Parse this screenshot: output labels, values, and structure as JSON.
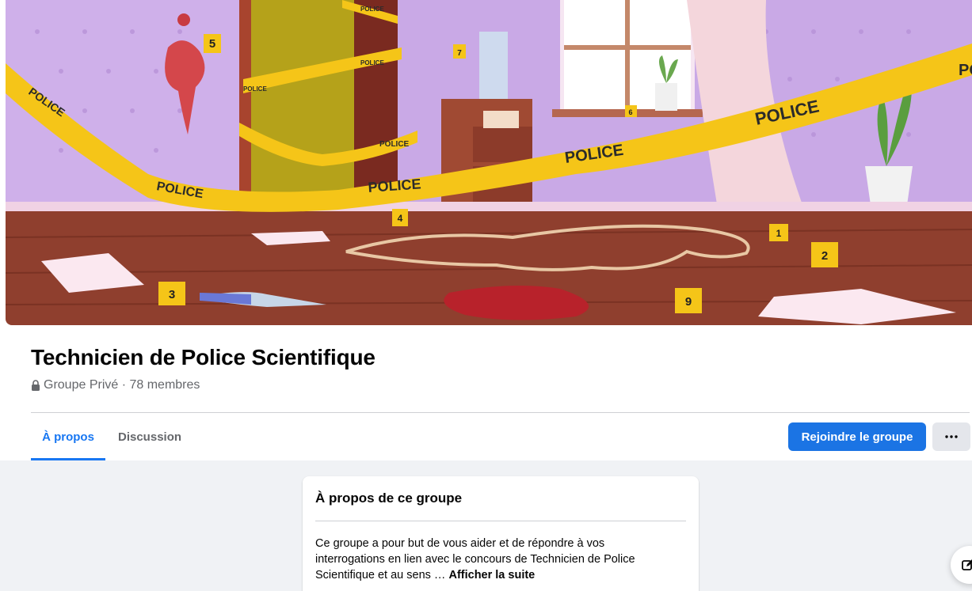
{
  "cover": {
    "alt": "Crime scene illustration",
    "tape_text": "POLICE",
    "markers": [
      "1",
      "2",
      "3",
      "4",
      "5",
      "6",
      "7",
      "9"
    ]
  },
  "group": {
    "name": "Technicien de Police Scientifique",
    "meta": "Groupe Privé · 78 membres"
  },
  "tabs": {
    "about": "À propos",
    "discussion": "Discussion"
  },
  "actions": {
    "join": "Rejoindre le groupe",
    "more": "···"
  },
  "about_card": {
    "title": "À propos de ce groupe",
    "description": "Ce groupe a pour but de vous aider et de répondre à vos interrogations en lien avec le concours de Technicien de Police Scientifique et au sens … ",
    "see_more": "Afficher la suite"
  },
  "colors": {
    "accent": "#1877f2",
    "button_bg": "#1b74e4",
    "page_bg": "#f0f2f5"
  }
}
